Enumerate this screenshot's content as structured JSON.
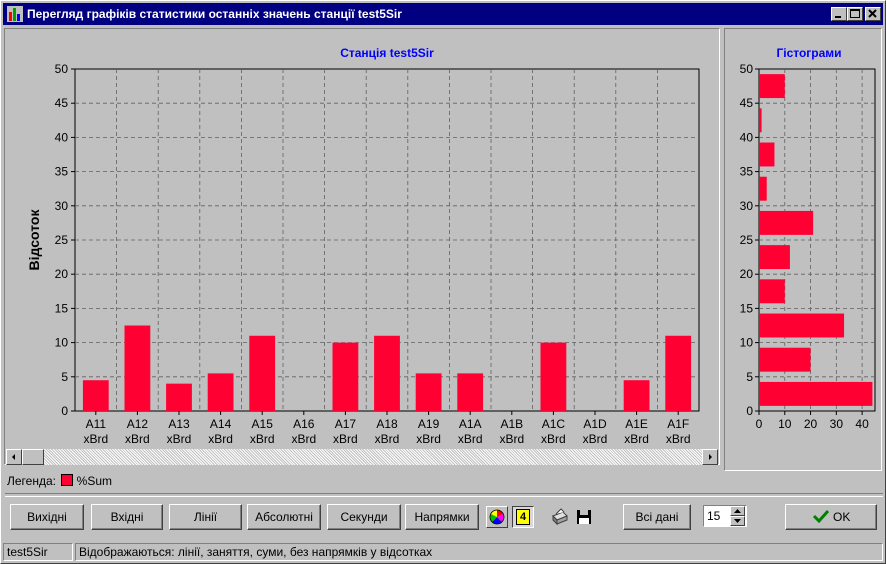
{
  "window": {
    "title": "Перегляд графіків статистики останніх значень станції test5Sir"
  },
  "colors": {
    "bar": "#ff0033",
    "title_blue": "#0000ff"
  },
  "chart_data": [
    {
      "type": "bar",
      "title": "Станція test5Sir",
      "ylabel": "Відсоток",
      "ylim": [
        0,
        50
      ],
      "yticks": [
        0,
        5,
        10,
        15,
        20,
        25,
        30,
        35,
        40,
        45,
        50
      ],
      "categories": [
        [
          "A11",
          "xBrd"
        ],
        [
          "A12",
          "xBrd"
        ],
        [
          "A13",
          "xBrd"
        ],
        [
          "A14",
          "xBrd"
        ],
        [
          "A15",
          "xBrd"
        ],
        [
          "A16",
          "xBrd"
        ],
        [
          "A17",
          "xBrd"
        ],
        [
          "A18",
          "xBrd"
        ],
        [
          "A19",
          "xBrd"
        ],
        [
          "A1A",
          "xBrd"
        ],
        [
          "A1B",
          "xBrd"
        ],
        [
          "A1C",
          "xBrd"
        ],
        [
          "A1D",
          "xBrd"
        ],
        [
          "A1E",
          "xBrd"
        ],
        [
          "A1F",
          "xBrd"
        ]
      ],
      "series": [
        {
          "name": "%Sum",
          "values": [
            4.5,
            12.5,
            4,
            5.5,
            11,
            0,
            10,
            11,
            5.5,
            5.5,
            0,
            10,
            0,
            4.5,
            11
          ]
        }
      ],
      "grid": true
    },
    {
      "type": "bar",
      "orientation": "horizontal",
      "title": "Гістограми",
      "ylim": [
        0,
        50
      ],
      "yticks": [
        0,
        5,
        10,
        15,
        20,
        25,
        30,
        35,
        40,
        45,
        50
      ],
      "xlim": [
        0,
        45
      ],
      "xticks": [
        0,
        10,
        20,
        30,
        40
      ],
      "bins": [
        {
          "from": 0,
          "to": 5,
          "count": 44
        },
        {
          "from": 5,
          "to": 10,
          "count": 20
        },
        {
          "from": 10,
          "to": 15,
          "count": 33
        },
        {
          "from": 15,
          "to": 20,
          "count": 10
        },
        {
          "from": 20,
          "to": 25,
          "count": 12
        },
        {
          "from": 25,
          "to": 30,
          "count": 21
        },
        {
          "from": 30,
          "to": 35,
          "count": 3
        },
        {
          "from": 35,
          "to": 40,
          "count": 6
        },
        {
          "from": 40,
          "to": 45,
          "count": 1
        },
        {
          "from": 45,
          "to": 50,
          "count": 10
        }
      ],
      "grid": true
    }
  ],
  "legend": {
    "label": "Легенда:",
    "entry": "%Sum"
  },
  "toolbar": {
    "outputs": "Вихідні",
    "inputs": "Вхідні",
    "lines": "Лінії",
    "absolute": "Абсолютні",
    "seconds": "Секунди",
    "directions": "Напрямки",
    "chart_count": "4",
    "all_data": "Всі дані",
    "spinner_value": "15",
    "ok": "OK"
  },
  "icons": [
    "palette-icon",
    "count-icon",
    "printer-icon",
    "floppy-disk-icon",
    "checkmark-icon"
  ],
  "statusbar": {
    "station": "test5Sir",
    "message": "Відображаються: лінії, заняття, суми, без напрямків у відсотках"
  }
}
